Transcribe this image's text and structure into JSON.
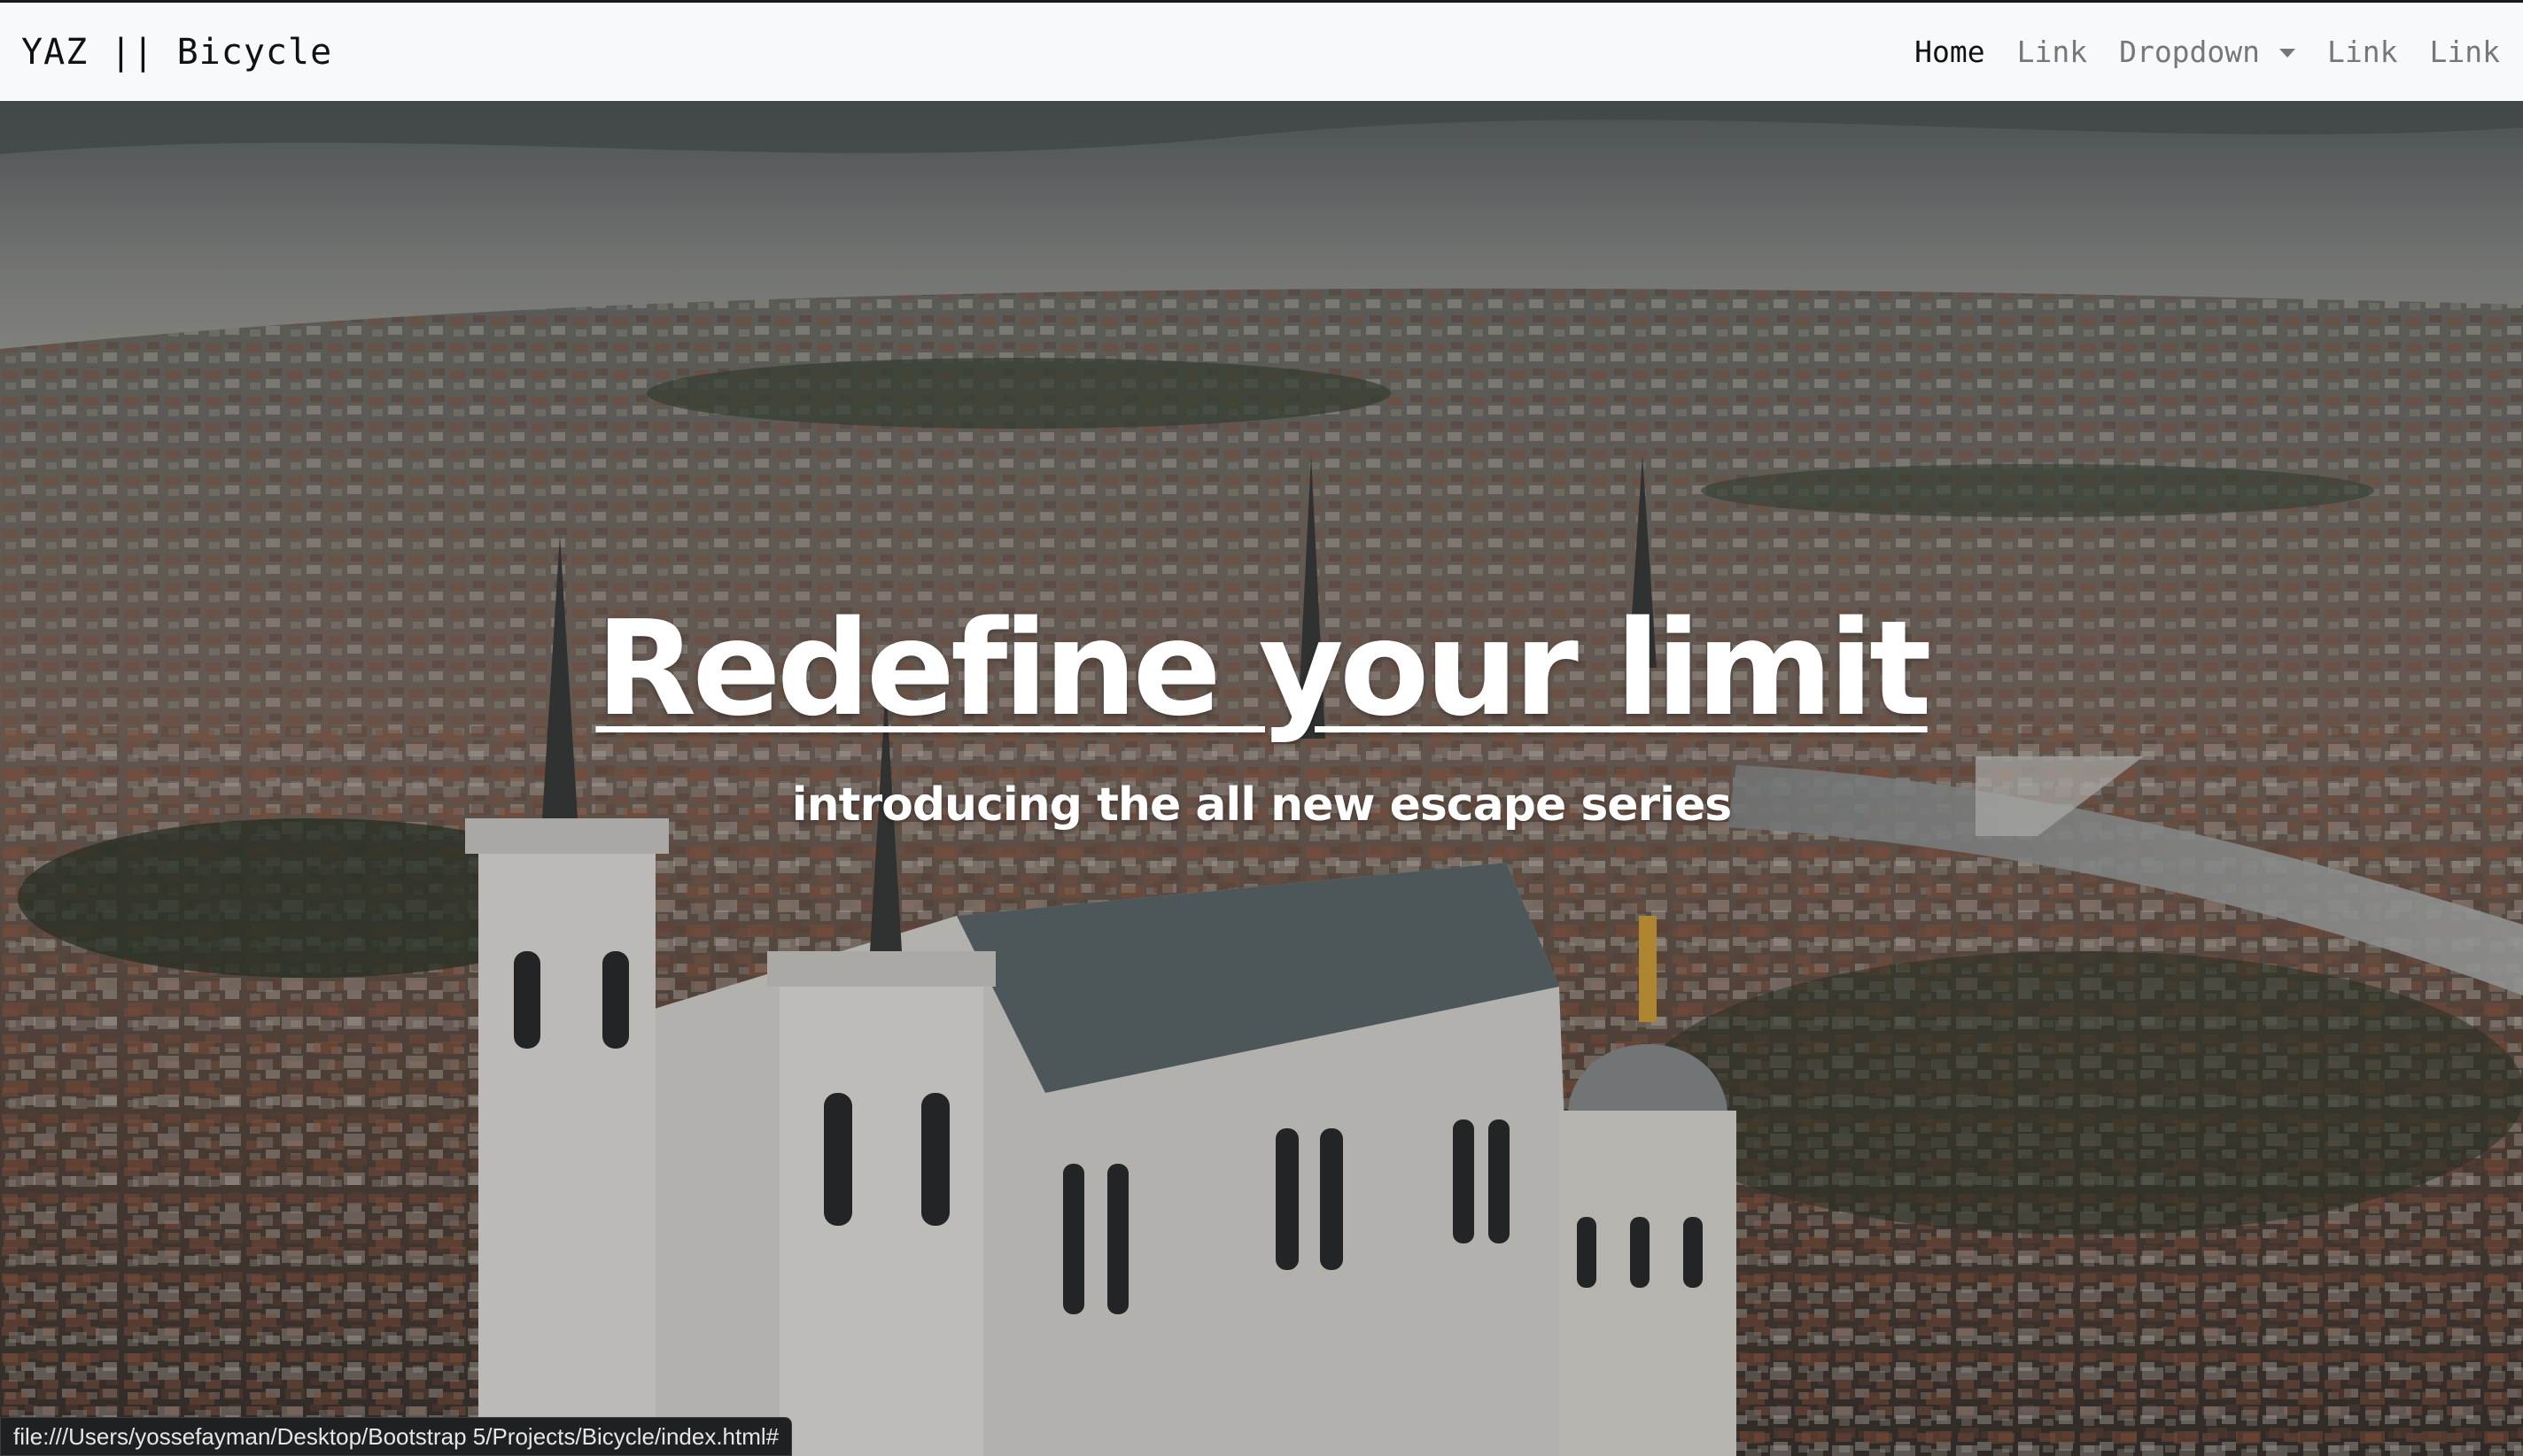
{
  "navbar": {
    "brand": "YAZ || Bicycle",
    "links": [
      {
        "label": "Home",
        "active": true
      },
      {
        "label": "Link",
        "active": false
      },
      {
        "label": "Dropdown",
        "active": false,
        "has_caret": true
      },
      {
        "label": "Link",
        "active": false
      },
      {
        "label": "Link",
        "active": false
      }
    ]
  },
  "hero": {
    "title": "Redefine your limit",
    "subtitle": "introducing the all new escape series",
    "background": "aerial city photo with cathedral"
  },
  "status_bar": {
    "url": "file:///Users/yossefayman/Desktop/Bootstrap 5/Projects/Bicycle/index.html#"
  },
  "colors": {
    "navbar_bg": "#f8f9fa",
    "nav_active": "#111111",
    "nav_inactive": "#777777",
    "hero_text": "#ffffff"
  }
}
